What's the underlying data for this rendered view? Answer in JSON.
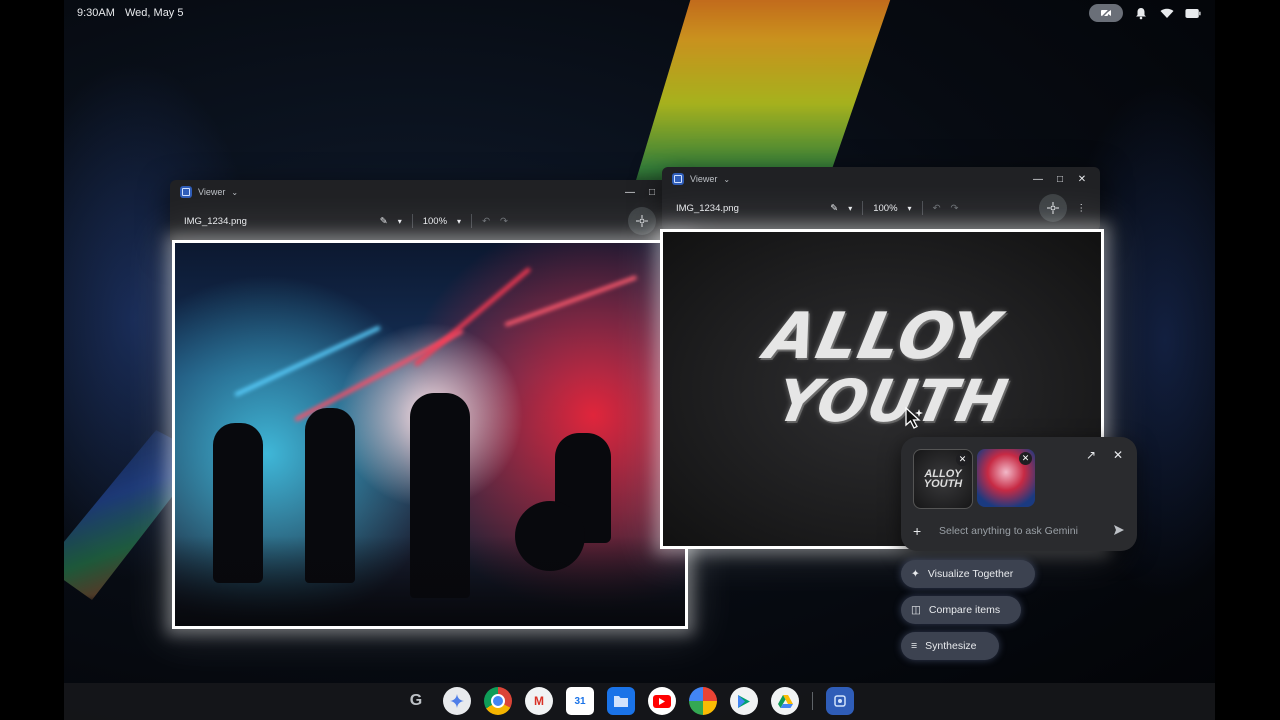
{
  "status_bar": {
    "time": "9:30AM",
    "date": "Wed, May 5"
  },
  "windows": [
    {
      "app_name": "Viewer",
      "file_name": "IMG_1234.png",
      "zoom": "100%"
    },
    {
      "app_name": "Viewer",
      "file_name": "IMG_1234.png",
      "zoom": "100%"
    }
  ],
  "artwork": {
    "logo_line1": "ALLOY",
    "logo_line2": "YOUTH"
  },
  "gemini": {
    "placeholder": "Select anything to ask Gemini",
    "chip_logo_line1": "ALLOY",
    "chip_logo_line2": "YOUTH"
  },
  "suggestions": [
    {
      "label": "Visualize Together"
    },
    {
      "label": "Compare items"
    },
    {
      "label": "Synthesize"
    }
  ],
  "shelf": {
    "apps": [
      {
        "name": "Google Search",
        "glyph": "G"
      },
      {
        "name": "Gemini"
      },
      {
        "name": "Chrome"
      },
      {
        "name": "Gmail",
        "glyph": "M"
      },
      {
        "name": "Calendar",
        "glyph": "31"
      },
      {
        "name": "Files"
      },
      {
        "name": "YouTube"
      },
      {
        "name": "Photos"
      },
      {
        "name": "Play Store"
      },
      {
        "name": "Drive"
      },
      {
        "name": "Viewer"
      }
    ]
  },
  "colors": {
    "accent": "#2f5db8",
    "suggestion_bg": "#3c4250",
    "panel_bg": "#2a2b2e"
  }
}
